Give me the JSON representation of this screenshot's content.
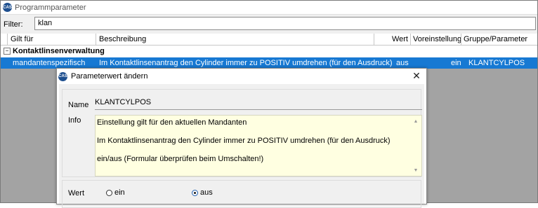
{
  "window": {
    "title": "Programmparameter",
    "app_icon_text": "CAS"
  },
  "filter": {
    "label": "Filter:",
    "value": "klan"
  },
  "grid": {
    "columns": [
      "Gilt für",
      "Beschreibung",
      "Wert",
      "Voreinstellung",
      "Gruppe/Parameter"
    ],
    "group": {
      "expander": "−",
      "label": "Kontaktlinsenverwaltung"
    },
    "rows": [
      {
        "gilt_fuer": "mandantenspezifisch",
        "beschreibung": "Im Kontaktlinsenantrag den Cylinder immer zu POSITIV umdrehen (für den Ausdruck)",
        "wert": "aus",
        "voreinstellung": "ein",
        "gruppe_parameter": "KLANTCYLPOS"
      }
    ]
  },
  "dialog": {
    "title": "Parameterwert ändern",
    "close_glyph": "✕",
    "name_label": "Name",
    "name_value": "KLANTCYLPOS",
    "info_label": "Info",
    "info_lines": [
      "Einstellung gilt für den aktuellen Mandanten",
      "Im Kontaktlinsenantrag den Cylinder immer zu POSITIV umdrehen (für den Ausdruck)",
      "ein/aus (Formular überprüfen beim Umschalten!)"
    ],
    "wert_label": "Wert",
    "options": [
      {
        "label": "ein",
        "checked": false
      },
      {
        "label": "aus",
        "checked": true
      }
    ]
  },
  "colors": {
    "selection": "#1779d3",
    "info_background": "#ffffe1",
    "background_gray": "#a3a3a3"
  }
}
